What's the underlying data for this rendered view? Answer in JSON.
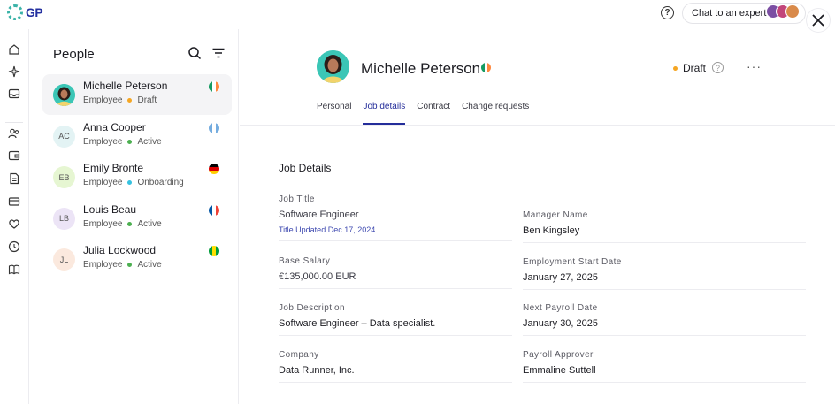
{
  "topbar": {
    "logo_text": "GP",
    "help_label": "?",
    "chat_label": "Chat to an expert"
  },
  "people": {
    "title": "People",
    "list": [
      {
        "initials": "",
        "name": "Michelle Peterson",
        "role": "Employee",
        "status": "Draft",
        "status_color": "#f5a623",
        "flag": [
          "#169b62",
          "#ffffff",
          "#ff883e"
        ],
        "selected": true
      },
      {
        "initials": "AC",
        "name": "Anna Cooper",
        "role": "Employee",
        "status": "Active",
        "status_color": "#4caf50",
        "flag": [
          "#74acdf",
          "#ffffff",
          "#74acdf"
        ],
        "selected": false
      },
      {
        "initials": "EB",
        "name": "Emily Bronte",
        "role": "Employee",
        "status": "Onboarding",
        "status_color": "#36c2e0",
        "flag": [
          "#000000",
          "#dd0000",
          "#ffce00"
        ],
        "selected": false
      },
      {
        "initials": "LB",
        "name": "Louis Beau",
        "role": "Employee",
        "status": "Active",
        "status_color": "#4caf50",
        "flag": [
          "#0055a4",
          "#ffffff",
          "#ef4135"
        ],
        "selected": false
      },
      {
        "initials": "JL",
        "name": "Julia Lockwood",
        "role": "Employee",
        "status": "Active",
        "status_color": "#4caf50",
        "flag": [
          "#009c3b",
          "#ffdf00",
          "#009c3b"
        ],
        "selected": false
      }
    ]
  },
  "profile": {
    "name": "Michelle Peterson",
    "status": "Draft",
    "status_help": "?",
    "more": "···",
    "tabs": [
      "Personal",
      "Job details",
      "Contract",
      "Change requests"
    ],
    "active_tab": "Job details"
  },
  "job_details": {
    "title": "Job Details",
    "left": [
      {
        "label": "Job Title",
        "value": "Software Engineer",
        "note": "Title Updated Dec 17, 2024"
      },
      {
        "label": "Base Salary",
        "value": "€135,000.00 EUR"
      },
      {
        "label": "Job Description",
        "value": "Software Engineer – Data specialist."
      },
      {
        "label": "Company",
        "value": "Data Runner, Inc."
      }
    ],
    "right": [
      {
        "label": "Manager Name",
        "value": "Ben Kingsley"
      },
      {
        "label": "Employment Start Date",
        "value": "January 27, 2025"
      },
      {
        "label": "Next Payroll Date",
        "value": "January 30, 2025"
      },
      {
        "label": "Payroll Approver",
        "value": "Emmaline Suttell"
      }
    ]
  },
  "colors": {
    "accent": "#242d9a",
    "draft": "#f5a623",
    "active": "#4caf50",
    "onboarding": "#36c2e0"
  }
}
